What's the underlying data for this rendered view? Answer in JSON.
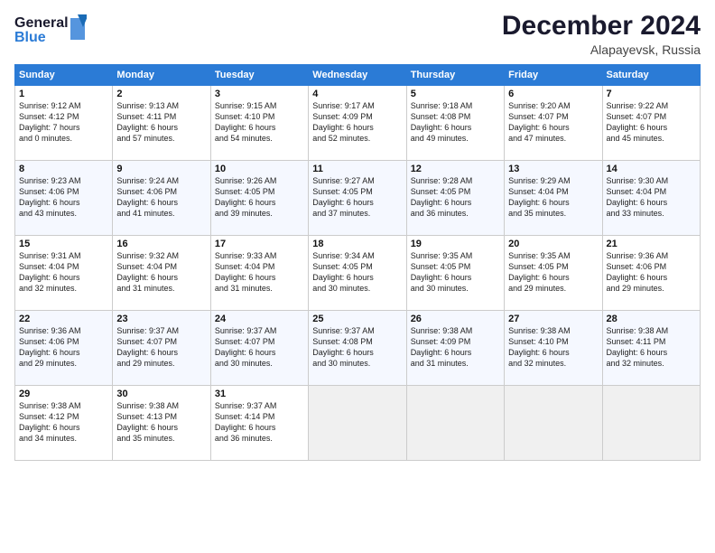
{
  "header": {
    "logo_line1": "General",
    "logo_line2": "Blue",
    "month": "December 2024",
    "location": "Alapayevsk, Russia"
  },
  "weekdays": [
    "Sunday",
    "Monday",
    "Tuesday",
    "Wednesday",
    "Thursday",
    "Friday",
    "Saturday"
  ],
  "weeks": [
    [
      {
        "day": "1",
        "info": "Sunrise: 9:12 AM\nSunset: 4:12 PM\nDaylight: 7 hours\nand 0 minutes."
      },
      {
        "day": "2",
        "info": "Sunrise: 9:13 AM\nSunset: 4:11 PM\nDaylight: 6 hours\nand 57 minutes."
      },
      {
        "day": "3",
        "info": "Sunrise: 9:15 AM\nSunset: 4:10 PM\nDaylight: 6 hours\nand 54 minutes."
      },
      {
        "day": "4",
        "info": "Sunrise: 9:17 AM\nSunset: 4:09 PM\nDaylight: 6 hours\nand 52 minutes."
      },
      {
        "day": "5",
        "info": "Sunrise: 9:18 AM\nSunset: 4:08 PM\nDaylight: 6 hours\nand 49 minutes."
      },
      {
        "day": "6",
        "info": "Sunrise: 9:20 AM\nSunset: 4:07 PM\nDaylight: 6 hours\nand 47 minutes."
      },
      {
        "day": "7",
        "info": "Sunrise: 9:22 AM\nSunset: 4:07 PM\nDaylight: 6 hours\nand 45 minutes."
      }
    ],
    [
      {
        "day": "8",
        "info": "Sunrise: 9:23 AM\nSunset: 4:06 PM\nDaylight: 6 hours\nand 43 minutes."
      },
      {
        "day": "9",
        "info": "Sunrise: 9:24 AM\nSunset: 4:06 PM\nDaylight: 6 hours\nand 41 minutes."
      },
      {
        "day": "10",
        "info": "Sunrise: 9:26 AM\nSunset: 4:05 PM\nDaylight: 6 hours\nand 39 minutes."
      },
      {
        "day": "11",
        "info": "Sunrise: 9:27 AM\nSunset: 4:05 PM\nDaylight: 6 hours\nand 37 minutes."
      },
      {
        "day": "12",
        "info": "Sunrise: 9:28 AM\nSunset: 4:05 PM\nDaylight: 6 hours\nand 36 minutes."
      },
      {
        "day": "13",
        "info": "Sunrise: 9:29 AM\nSunset: 4:04 PM\nDaylight: 6 hours\nand 35 minutes."
      },
      {
        "day": "14",
        "info": "Sunrise: 9:30 AM\nSunset: 4:04 PM\nDaylight: 6 hours\nand 33 minutes."
      }
    ],
    [
      {
        "day": "15",
        "info": "Sunrise: 9:31 AM\nSunset: 4:04 PM\nDaylight: 6 hours\nand 32 minutes."
      },
      {
        "day": "16",
        "info": "Sunrise: 9:32 AM\nSunset: 4:04 PM\nDaylight: 6 hours\nand 31 minutes."
      },
      {
        "day": "17",
        "info": "Sunrise: 9:33 AM\nSunset: 4:04 PM\nDaylight: 6 hours\nand 31 minutes."
      },
      {
        "day": "18",
        "info": "Sunrise: 9:34 AM\nSunset: 4:05 PM\nDaylight: 6 hours\nand 30 minutes."
      },
      {
        "day": "19",
        "info": "Sunrise: 9:35 AM\nSunset: 4:05 PM\nDaylight: 6 hours\nand 30 minutes."
      },
      {
        "day": "20",
        "info": "Sunrise: 9:35 AM\nSunset: 4:05 PM\nDaylight: 6 hours\nand 29 minutes."
      },
      {
        "day": "21",
        "info": "Sunrise: 9:36 AM\nSunset: 4:06 PM\nDaylight: 6 hours\nand 29 minutes."
      }
    ],
    [
      {
        "day": "22",
        "info": "Sunrise: 9:36 AM\nSunset: 4:06 PM\nDaylight: 6 hours\nand 29 minutes."
      },
      {
        "day": "23",
        "info": "Sunrise: 9:37 AM\nSunset: 4:07 PM\nDaylight: 6 hours\nand 29 minutes."
      },
      {
        "day": "24",
        "info": "Sunrise: 9:37 AM\nSunset: 4:07 PM\nDaylight: 6 hours\nand 30 minutes."
      },
      {
        "day": "25",
        "info": "Sunrise: 9:37 AM\nSunset: 4:08 PM\nDaylight: 6 hours\nand 30 minutes."
      },
      {
        "day": "26",
        "info": "Sunrise: 9:38 AM\nSunset: 4:09 PM\nDaylight: 6 hours\nand 31 minutes."
      },
      {
        "day": "27",
        "info": "Sunrise: 9:38 AM\nSunset: 4:10 PM\nDaylight: 6 hours\nand 32 minutes."
      },
      {
        "day": "28",
        "info": "Sunrise: 9:38 AM\nSunset: 4:11 PM\nDaylight: 6 hours\nand 32 minutes."
      }
    ],
    [
      {
        "day": "29",
        "info": "Sunrise: 9:38 AM\nSunset: 4:12 PM\nDaylight: 6 hours\nand 34 minutes."
      },
      {
        "day": "30",
        "info": "Sunrise: 9:38 AM\nSunset: 4:13 PM\nDaylight: 6 hours\nand 35 minutes."
      },
      {
        "day": "31",
        "info": "Sunrise: 9:37 AM\nSunset: 4:14 PM\nDaylight: 6 hours\nand 36 minutes."
      },
      null,
      null,
      null,
      null
    ]
  ]
}
